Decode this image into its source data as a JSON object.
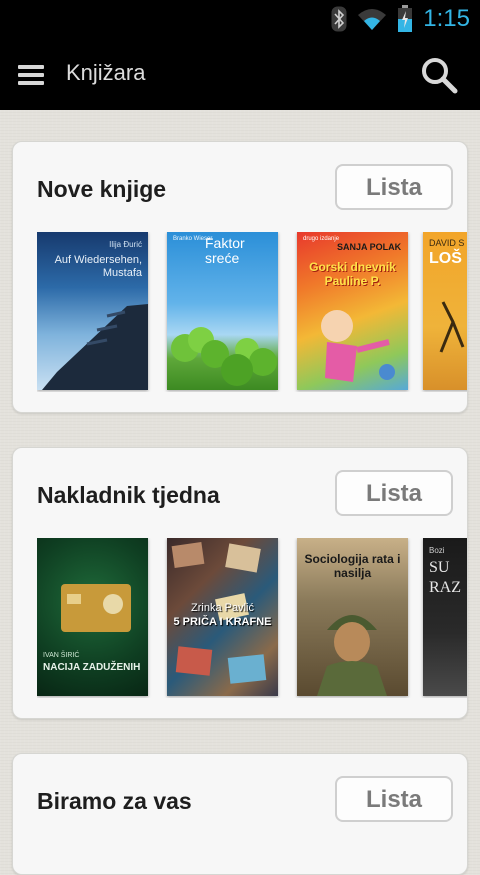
{
  "status_bar": {
    "time": "1:15",
    "icons": [
      "bluetooth-icon",
      "wifi-icon",
      "battery-icon"
    ],
    "time_color": "#33b5e5"
  },
  "action_bar": {
    "title": "Knjižara",
    "menu_icon": "hamburger-menu-icon",
    "search_icon": "search-icon"
  },
  "sections": [
    {
      "title": "Nove knjige",
      "button_label": "Lista",
      "books": [
        {
          "author": "Ilija Đurić",
          "title": "Auf Wiedersehen, Mustafa"
        },
        {
          "author": "Branko Wieser",
          "title": "Faktor sreće"
        },
        {
          "publisher": "drugo izdanje",
          "author": "SANJA POLAK",
          "title": "Gorski dnevnik Pauline P."
        },
        {
          "author": "DAVID S",
          "title": "LOŠ"
        }
      ]
    },
    {
      "title": "Nakladnik tjedna",
      "button_label": "Lista",
      "books": [
        {
          "author": "IVAN ŠIRIĆ",
          "title": "NACIJA ZADUŽENIH"
        },
        {
          "author": "Zrinka Pavlić",
          "title": "5 PRIČA I KRAFNE"
        },
        {
          "title": "Sociologija rata i nasilja"
        },
        {
          "author": "Bozi",
          "title": "SU RAZ"
        }
      ]
    },
    {
      "title": "Biramo za vas",
      "button_label": "Lista"
    }
  ]
}
